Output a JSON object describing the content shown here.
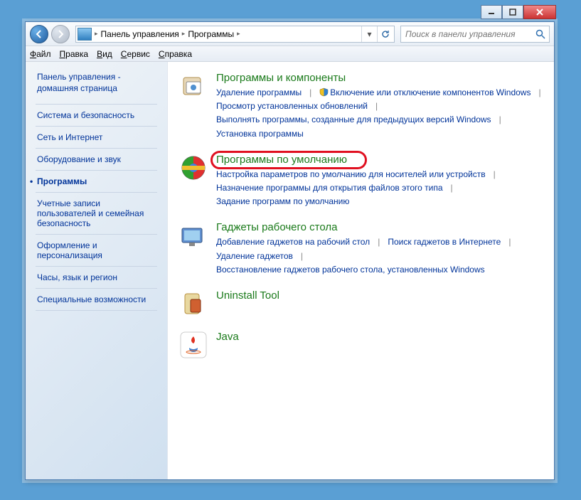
{
  "breadcrumb": {
    "root": "Панель управления",
    "current": "Программы"
  },
  "search": {
    "placeholder": "Поиск в панели управления"
  },
  "menu": {
    "file": "Файл",
    "edit": "Правка",
    "view": "Вид",
    "tools": "Сервис",
    "help": "Справка"
  },
  "sidebar": {
    "home1": "Панель управления -",
    "home2": "домашняя страница",
    "items": [
      "Система и безопасность",
      "Сеть и Интернет",
      "Оборудование и звук",
      "Программы",
      "Учетные записи пользователей и семейная безопасность",
      "Оформление и персонализация",
      "Часы, язык и регион",
      "Специальные возможности"
    ],
    "active_index": 3
  },
  "categories": [
    {
      "title": "Программы и компоненты",
      "icon": "programs",
      "tasks": [
        {
          "label": "Удаление программы",
          "shield": false
        },
        {
          "label": "Включение или отключение компонентов Windows",
          "shield": true
        },
        {
          "label": "Просмотр установленных обновлений",
          "shield": false
        },
        {
          "label": "Выполнять программы, созданные для предыдущих версий Windows",
          "shield": false
        },
        {
          "label": "Установка программы",
          "shield": false
        }
      ]
    },
    {
      "title": "Программы по умолчанию",
      "icon": "defaults",
      "highlighted": true,
      "tasks": [
        {
          "label": "Настройка параметров по умолчанию для носителей или устройств",
          "shield": false
        },
        {
          "label": "Назначение программы для открытия файлов этого типа",
          "shield": false
        },
        {
          "label": "Задание программ по умолчанию",
          "shield": false
        }
      ]
    },
    {
      "title": "Гаджеты рабочего стола",
      "icon": "gadgets",
      "tasks": [
        {
          "label": "Добавление гаджетов на рабочий стол",
          "shield": false
        },
        {
          "label": "Поиск гаджетов в Интернете",
          "shield": false
        },
        {
          "label": "Удаление гаджетов",
          "shield": false
        },
        {
          "label": "Восстановление гаджетов рабочего стола, установленных Windows",
          "shield": false
        }
      ]
    },
    {
      "title": "Uninstall Tool",
      "icon": "uninstall",
      "tasks": []
    },
    {
      "title": "Java",
      "icon": "java",
      "tasks": []
    }
  ]
}
